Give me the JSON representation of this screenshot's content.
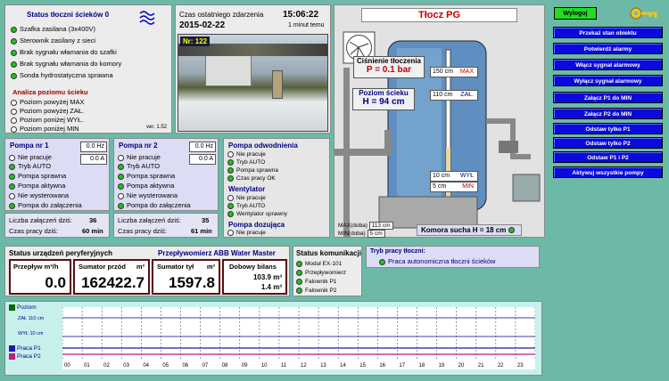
{
  "status": {
    "title": "Status tłoczni ścieków",
    "count": "0",
    "items": [
      "Szafka zasilana (3x400V)",
      "Sterownik zasilany z sieci",
      "Brak sygnału włamania do szafki",
      "Brak sygnału włamania do komory",
      "Sonda hydrostatyczna sprawna"
    ],
    "analysis_title": "Analiza poziomu ścieku",
    "levels": [
      "Poziom powyżej MAX",
      "Poziom powyżej ZAŁ.",
      "Poziom poniżej WYŁ.",
      "Poziom poniżej MIN"
    ],
    "version": "ver. 1.52"
  },
  "event": {
    "label": "Czas ostatniego zdarzenia",
    "time": "15:06:22",
    "date": "2015-02-22",
    "ago": "1 minut temu",
    "camera": "Nr: 122"
  },
  "pump1": {
    "title": "Pompa nr 1",
    "hz": "0.0 Hz",
    "a": "0.0 A",
    "items": [
      "Nie pracuje",
      "Tryb AUTO",
      "Pompa sprawna",
      "Pompa aktywna",
      "Nie wysterowana",
      "Pompa do załączenia"
    ],
    "starts_label": "Liczba załączeń dziś:",
    "starts": "36",
    "time_label": "Czas pracy dziś:",
    "time": "60 min"
  },
  "pump2": {
    "title": "Pompa nr 2",
    "hz": "0.0 Hz",
    "a": "0.0 A",
    "items": [
      "Nie pracuje",
      "Tryb AUTO",
      "Pompa sprawna",
      "Pompa aktywna",
      "Nie wysterowana",
      "Pompa do załączenia"
    ],
    "starts_label": "Liczba załączeń dziś:",
    "starts": "35",
    "time_label": "Czas pracy dziś:",
    "time": "61 min"
  },
  "drain": {
    "title": "Pompa odwodnienia",
    "items": [
      "Nie pracuje",
      "Tryb AUTO",
      "Pompa sprawna",
      "Czas pracy OK"
    ],
    "fan_title": "Wentylator",
    "fan_items": [
      "Nie pracuje",
      "Tryb AUTO",
      "Wentylator sprawny"
    ],
    "dose_title": "Pompa dozująca",
    "dose_items": [
      "Nie pracuje"
    ]
  },
  "station": {
    "title": "Tłocz PG",
    "pressure_label": "Ciśnienie tłoczenia",
    "pressure": "P = 0.1 bar",
    "level_label": "Poziom ścieku",
    "level": "H = 94 cm",
    "max_cm": "150 cm",
    "max": "MAX",
    "zal_cm": "110 cm",
    "zal": "ZAŁ.",
    "wyl_cm": "10 cm",
    "wyl": "WYŁ",
    "min_cm": "5 cm",
    "min": "MIN",
    "maxd_label": "MAX(doba)",
    "maxd": "113 cm",
    "mind_label": "MIN(doba)",
    "mind": "5 cm",
    "dry": "Komora sucha  H = 18 cm"
  },
  "buttons": {
    "logout": "Wyloguj",
    "list": [
      "Przekaż stan obiektu",
      "Potwierdź alarmy",
      "Włącz sygnał alarmowy",
      "Wyłącz sygnał alarmowy",
      "Załącz P1 do MIN",
      "Załącz P2 do MIN",
      "Odstaw tylko P1",
      "Odstaw tylko P2",
      "Odstaw P1 i P2",
      "Aktywuj wszystkie pompy"
    ]
  },
  "periph": {
    "title": "Status urządzeń peryferyjnych",
    "flow_title": "Przepływomierz ABB Water Master",
    "flow_label": "Przepływ",
    "flow_unit": "m³/h",
    "flow": "0.0",
    "fwd_label": "Sumator przód",
    "fwd": "162422.7",
    "back_label": "Sumator tył",
    "back": "1597.8",
    "unit": "m³",
    "bal_label": "Dobowy bilans",
    "bal1": "103.9 m³",
    "bal2": "1.4 m³"
  },
  "comm": {
    "title": "Status komunikacji",
    "items": [
      "Moduł EX-101",
      "Przepływomierz",
      "Falownik P1",
      "Falownik P2"
    ]
  },
  "mode": {
    "title": "Tryb pracy tłoczni:",
    "value": "Praca autonomiczna tłoczni ścieków"
  },
  "trend": {
    "legend": [
      "Poziom",
      "ZAŁ 110 cm",
      "WYŁ 10 cm",
      "Praca P1",
      "Praca P2"
    ],
    "hours": [
      "00",
      "01",
      "02",
      "03",
      "04",
      "05",
      "06",
      "07",
      "08",
      "09",
      "10",
      "11",
      "12",
      "13",
      "14",
      "15",
      "16",
      "17",
      "18",
      "19",
      "20",
      "21",
      "22",
      "23"
    ]
  },
  "colors": {
    "bg": "#6cb9a8",
    "button": "#0a0adc",
    "logout": "#22dd22",
    "led_on": "#22c022"
  }
}
